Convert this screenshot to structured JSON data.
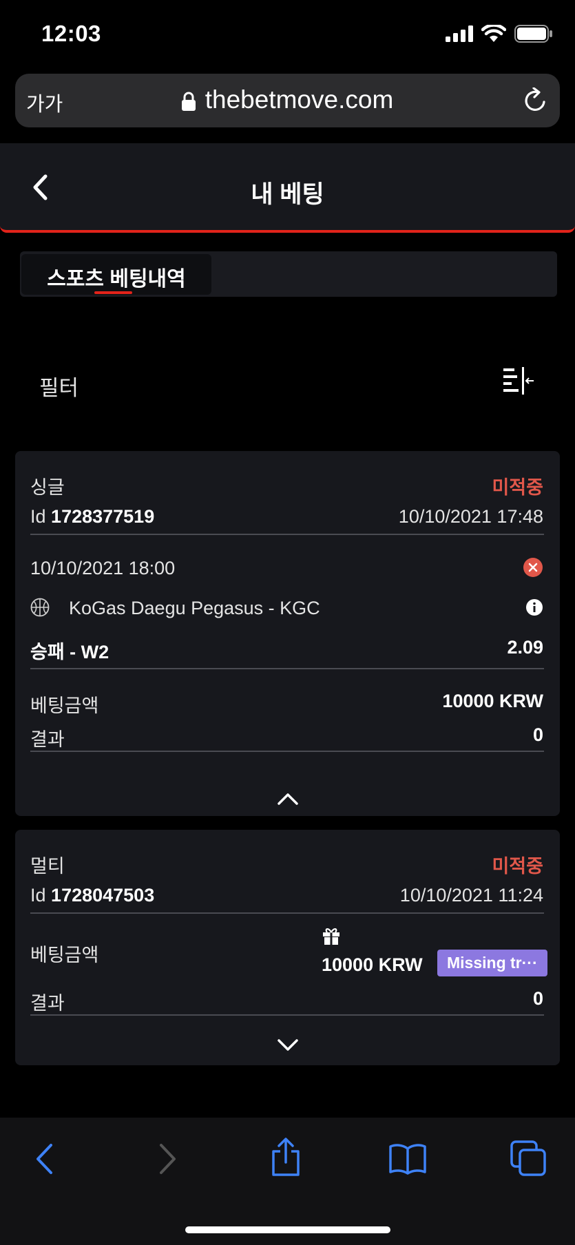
{
  "status_bar": {
    "time": "12:03"
  },
  "browser": {
    "text_size_label": "가가",
    "url": "thebetmove.com"
  },
  "header": {
    "title": "내 베팅"
  },
  "tabs": [
    {
      "label": "스포츠 베팅내역",
      "active": true
    }
  ],
  "filter": {
    "label": "필터"
  },
  "bets": [
    {
      "type": "싱글",
      "status": "미적중",
      "id_prefix": "Id",
      "id": "1728377519",
      "placed_at": "10/10/2021 17:48",
      "event_time": "10/10/2021 18:00",
      "sport_icon": "basketball-icon",
      "match": "KoGas Daegu Pegasus - KGC",
      "market": "승패 - W2",
      "odds": "2.09",
      "stake_label": "베팅금액",
      "stake": "10000 KRW",
      "result_label": "결과",
      "result": "0",
      "expanded": true
    },
    {
      "type": "멀티",
      "status": "미적중",
      "id_prefix": "Id",
      "id": "1728047503",
      "placed_at": "10/10/2021 11:24",
      "stake_label": "베팅금액",
      "stake": "10000 KRW",
      "badge": "Missing tr···",
      "result_label": "결과",
      "result": "0",
      "expanded": false
    }
  ],
  "colors": {
    "accent_red": "#e2231a",
    "status_red": "#e1574a",
    "badge_purple": "#8c78e0",
    "toolbar_blue": "#3e82f7"
  }
}
